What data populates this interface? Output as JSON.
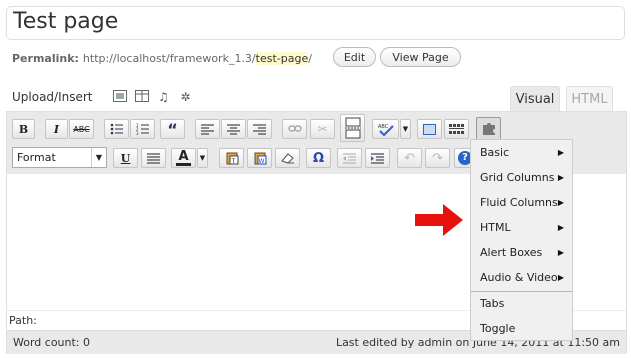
{
  "post": {
    "title": "Test page",
    "permalink_label": "Permalink:",
    "permalink_base": "http://localhost/framework_1.3/",
    "permalink_slug": "test-page",
    "permalink_tail": "/",
    "edit_label": "Edit",
    "view_label": "View Page"
  },
  "media": {
    "label": "Upload/Insert"
  },
  "tabs": {
    "visual": "Visual",
    "html": "HTML"
  },
  "toolbar": {
    "format_label": "Format"
  },
  "menu": {
    "items": [
      {
        "label": "Basic"
      },
      {
        "label": "Grid Columns"
      },
      {
        "label": "Fluid Columns"
      },
      {
        "label": "HTML"
      },
      {
        "label": "Alert Boxes"
      },
      {
        "label": "Audio & Video"
      },
      {
        "label": "Tabs"
      },
      {
        "label": "Toggle"
      }
    ],
    "arrow_color": "#e8120c"
  },
  "footer": {
    "path_label": "Path:",
    "word_count": "Word count: 0",
    "last_edited": "Last edited by admin on June 14, 2011 at 11:50 am"
  }
}
